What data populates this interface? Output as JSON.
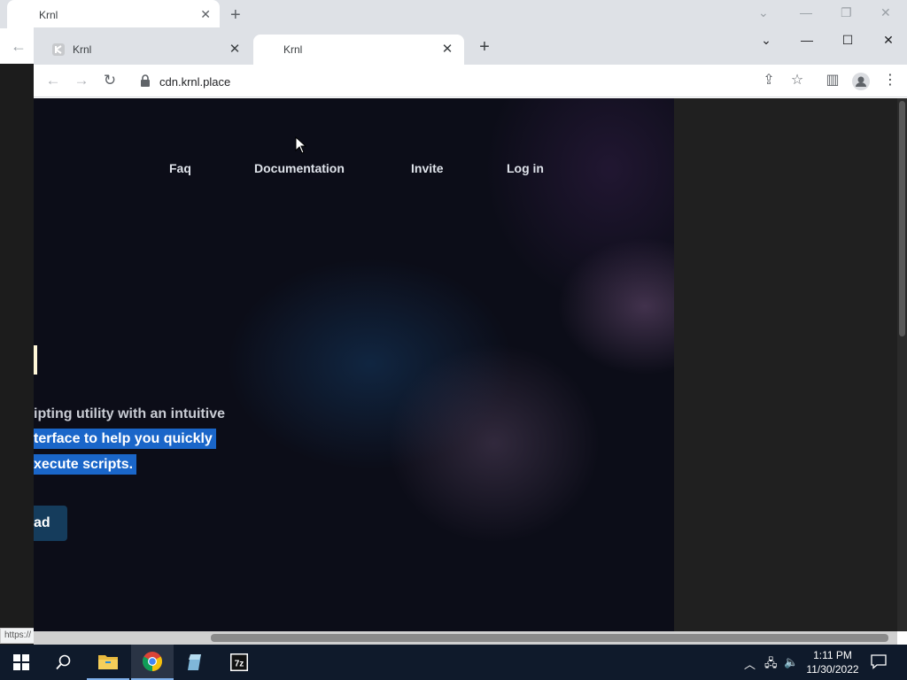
{
  "background_window": {
    "tab_title": "Krnl",
    "status_text": "https://"
  },
  "browser": {
    "tabs": [
      {
        "title": "Krnl",
        "active": false
      },
      {
        "title": "Krnl",
        "active": true
      }
    ],
    "address": "cdn.krnl.place"
  },
  "page": {
    "nav": [
      "Faq",
      "Documentation",
      "Invite",
      "Log in"
    ],
    "description_lines": [
      "ipting utility with an intuitive",
      "terface to help you quickly",
      "xecute scripts."
    ],
    "download_label": "ad"
  },
  "taskbar": {
    "clock_time": "1:11 PM",
    "clock_date": "11/30/2022",
    "apps": [
      "start-icon",
      "search-icon",
      "file-explorer-icon",
      "chrome-icon",
      "app-icon",
      "7zip-icon"
    ]
  }
}
